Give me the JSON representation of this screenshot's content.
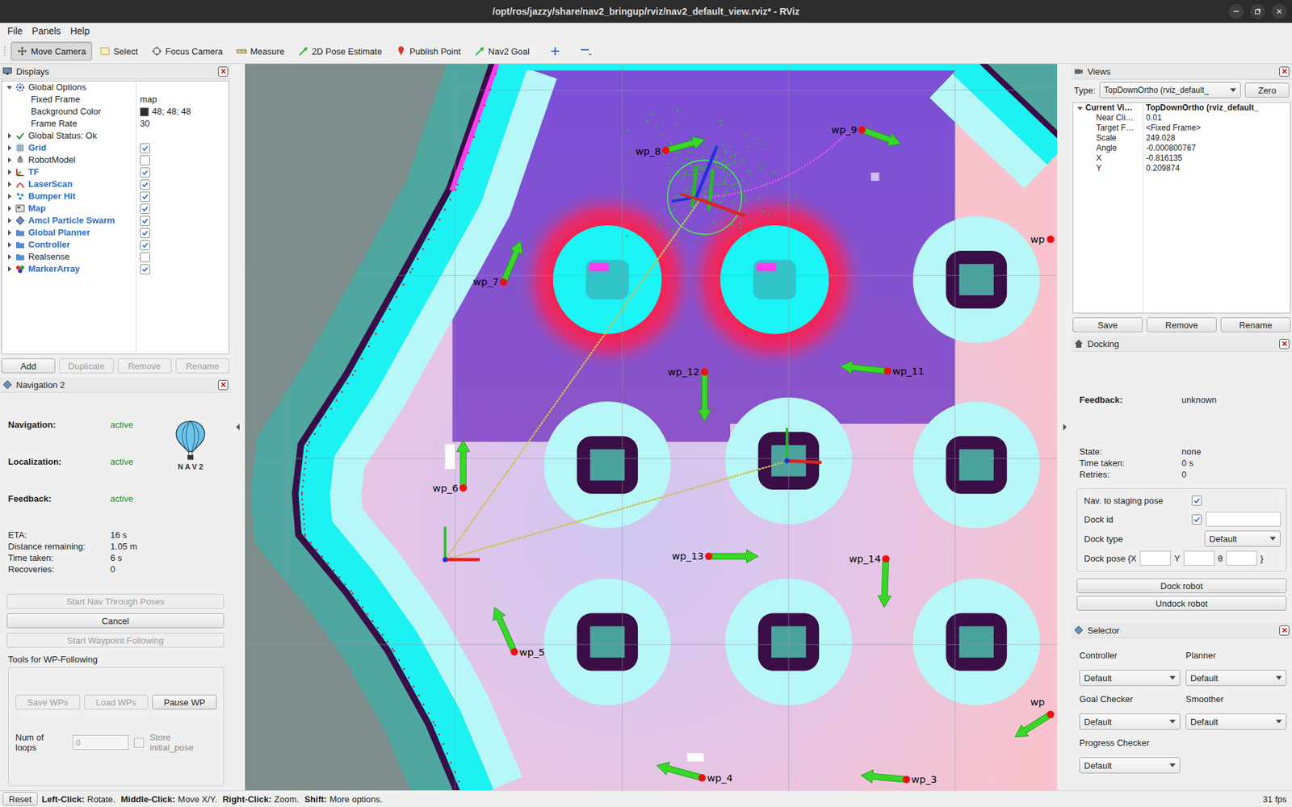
{
  "window": {
    "title": "/opt/ros/jazzy/share/nav2_bringup/rviz/nav2_default_view.rviz* - RViz"
  },
  "menu": [
    {
      "label": "File"
    },
    {
      "label": "Panels"
    },
    {
      "label": "Help"
    }
  ],
  "toolbar": [
    {
      "label": "Move Camera",
      "selected": true
    },
    {
      "label": "Select",
      "selected": false
    },
    {
      "label": "Focus Camera",
      "selected": false
    },
    {
      "label": "Measure",
      "selected": false
    },
    {
      "label": "2D Pose Estimate",
      "selected": false
    },
    {
      "label": "Publish Point",
      "selected": false
    },
    {
      "label": "Nav2 Goal",
      "selected": false
    }
  ],
  "displays": {
    "title": "Displays",
    "global_options": {
      "label": "Global Options",
      "expanded": true,
      "properties": [
        {
          "name": "Fixed Frame",
          "value": "map"
        },
        {
          "name": "Background Color",
          "value": "48; 48; 48",
          "color": "#303030"
        },
        {
          "name": "Frame Rate",
          "value": "30"
        }
      ]
    },
    "global_status": {
      "label": "Global Status: Ok",
      "expanded": false
    },
    "items": [
      {
        "name": "Grid",
        "checked": true,
        "expanded": false
      },
      {
        "name": "RobotModel",
        "checked": false,
        "expanded": false
      },
      {
        "name": "TF",
        "checked": true,
        "expanded": false
      },
      {
        "name": "LaserScan",
        "checked": true,
        "expanded": false
      },
      {
        "name": "Bumper Hit",
        "checked": true,
        "expanded": false
      },
      {
        "name": "Map",
        "checked": true,
        "expanded": false
      },
      {
        "name": "Amcl Particle Swarm",
        "checked": true,
        "expanded": false
      },
      {
        "name": "Global Planner",
        "checked": true,
        "expanded": false
      },
      {
        "name": "Controller",
        "checked": true,
        "expanded": false
      },
      {
        "name": "Realsense",
        "checked": false,
        "expanded": false
      },
      {
        "name": "MarkerArray",
        "checked": true,
        "expanded": false
      }
    ],
    "buttons": [
      {
        "label": "Add",
        "disabled": false
      },
      {
        "label": "Duplicate",
        "disabled": true
      },
      {
        "label": "Remove",
        "disabled": true
      },
      {
        "label": "Rename",
        "disabled": true
      }
    ]
  },
  "navigation": {
    "title": "Navigation 2",
    "status": [
      {
        "label": "Navigation:",
        "value": "active"
      },
      {
        "label": "Localization:",
        "value": "active"
      },
      {
        "label": "Feedback:",
        "value": "active"
      }
    ],
    "logo": "N A V 2",
    "stats": [
      {
        "label": "ETA:",
        "value": "16 s"
      },
      {
        "label": "Distance remaining:",
        "value": "1.05 m"
      },
      {
        "label": "Time taken:",
        "value": "6 s"
      },
      {
        "label": "Recoveries:",
        "value": "0"
      }
    ],
    "buttons": [
      {
        "label": "Start Nav Through Poses",
        "disabled": true
      },
      {
        "label": "Cancel",
        "disabled": false
      },
      {
        "label": "Start Waypoint Following",
        "disabled": true
      }
    ],
    "wp_tools": {
      "title": "Tools for WP-Following",
      "buttons": [
        {
          "label": "Save WPs",
          "disabled": true
        },
        {
          "label": "Load WPs",
          "disabled": true
        },
        {
          "label": "Pause WP",
          "disabled": false
        }
      ],
      "loops_label": "Num of loops",
      "loops_value": "0",
      "loops_disabled": true,
      "store_label": "Store initial_pose",
      "store_checked": false,
      "store_disabled": true
    }
  },
  "views": {
    "title": "Views",
    "type_label": "Type:",
    "type_value": "TopDownOrtho (rviz_default_",
    "zero": "Zero",
    "current": {
      "name": "Current Vi…",
      "value": "TopDownOrtho (rviz_default_",
      "expanded": true
    },
    "properties": [
      {
        "name": "Near Cli…",
        "value": "0.01"
      },
      {
        "name": "Target F…",
        "value": "<Fixed Frame>"
      },
      {
        "name": "Scale",
        "value": "249.028"
      },
      {
        "name": "Angle",
        "value": "-0.000800767"
      },
      {
        "name": "X",
        "value": "-0.816135"
      },
      {
        "name": "Y",
        "value": "0.209874"
      }
    ],
    "buttons": [
      {
        "label": "Save"
      },
      {
        "label": "Remove"
      },
      {
        "label": "Rename"
      }
    ]
  },
  "docking": {
    "title": "Docking",
    "feedback_label": "Feedback:",
    "feedback_value": "unknown",
    "info": [
      {
        "label": "State:",
        "value": "none"
      },
      {
        "label": "Time taken:",
        "value": "0 s"
      },
      {
        "label": "Retries:",
        "value": "0"
      }
    ],
    "staging": {
      "label": "Nav. to staging pose",
      "checked": true
    },
    "dock_id": {
      "label": "Dock id",
      "checked": true,
      "value": ""
    },
    "dock_type": {
      "label": "Dock type",
      "value": "Default"
    },
    "dock_pose": {
      "label": "Dock pose {X",
      "x": "",
      "y_label": "Y",
      "y": "",
      "theta_label": "θ",
      "theta": "",
      "close": "}"
    },
    "buttons": [
      {
        "label": "Dock robot"
      },
      {
        "label": "Undock robot"
      }
    ]
  },
  "selector": {
    "title": "Selector",
    "fields": [
      {
        "label": "Controller",
        "value": "Default"
      },
      {
        "label": "Planner",
        "value": "Default"
      },
      {
        "label": "Goal Checker",
        "value": "Default"
      },
      {
        "label": "Smoother",
        "value": "Default"
      },
      {
        "label": "Progress Checker",
        "value": "Default"
      }
    ]
  },
  "map": {
    "waypoints": [
      {
        "label": "wp_8"
      },
      {
        "label": "wp_9"
      },
      {
        "label": "wp_7"
      },
      {
        "label": "wp_6"
      },
      {
        "label": "wp_5"
      },
      {
        "label": "wp_4"
      },
      {
        "label": "wp_3"
      },
      {
        "label": "wp_11"
      },
      {
        "label": "wp_12"
      },
      {
        "label": "wp_13"
      },
      {
        "label": "wp_14"
      },
      {
        "label": "wp"
      },
      {
        "label": "wp"
      }
    ]
  },
  "status_bar": {
    "reset": "Reset",
    "hints": [
      {
        "key": "Left-Click:",
        "action": "Rotate."
      },
      {
        "key": "Middle-Click:",
        "action": "Move X/Y."
      },
      {
        "key": "Right-Click:",
        "action": "Zoom."
      },
      {
        "key": "Shift:",
        "action": "More options."
      }
    ],
    "fps": "31 fps"
  }
}
